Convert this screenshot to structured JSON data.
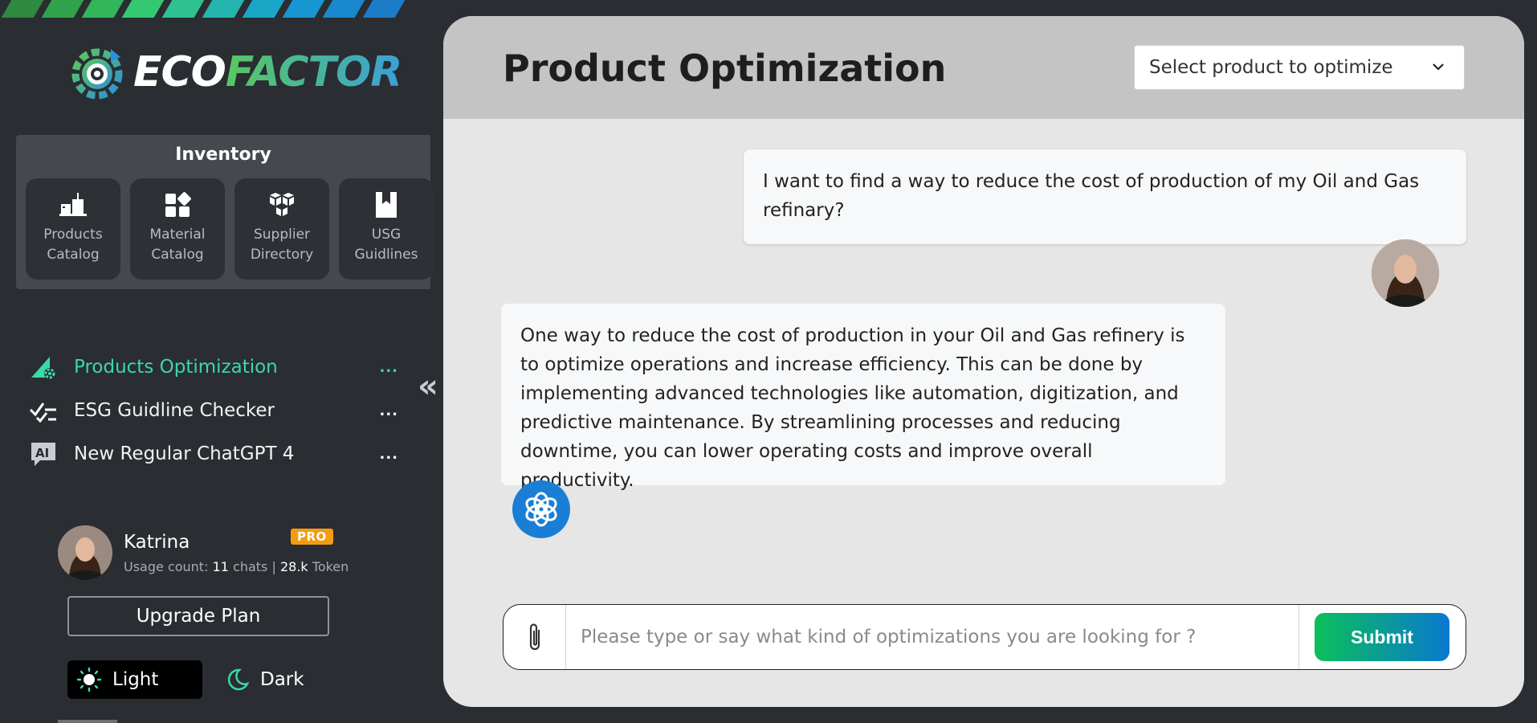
{
  "app": {
    "logo_eco": "ECO",
    "logo_factor": "FACTOR"
  },
  "colors": {
    "accent": "#3bd8a8",
    "sidebar_bg": "#2a2d32",
    "main_bg": "#e6e6e6",
    "header_bg": "#c4c4c4",
    "pro_badge": "#f39c12",
    "bot_avatar": "#1a7fd4"
  },
  "inventory": {
    "title": "Inventory",
    "cards": [
      {
        "icon": "products-catalog-icon",
        "line1": "Products",
        "line2": "Catalog"
      },
      {
        "icon": "material-catalog-icon",
        "line1": "Material",
        "line2": "Catalog"
      },
      {
        "icon": "supplier-directory-icon",
        "line1": "Supplier",
        "line2": "Directory"
      },
      {
        "icon": "usg-guidelines-icon",
        "line1": "USG",
        "line2": "Guidlines"
      }
    ]
  },
  "nav": {
    "items": [
      {
        "label": "Products Optimization",
        "icon": "optimization-icon",
        "active": true,
        "more": "..."
      },
      {
        "label": "ESG Guidline Checker",
        "icon": "checklist-icon",
        "active": false,
        "more": "..."
      },
      {
        "label": "New Regular ChatGPT 4",
        "icon": "ai-icon",
        "active": false,
        "more": "..."
      }
    ],
    "collapse_glyph": "«"
  },
  "profile": {
    "name": "Katrina",
    "badge": "PRO",
    "usage_prefix": "Usage count:",
    "chats_count": "11",
    "chats_label": "chats",
    "separator": "|",
    "tokens_count": "28.k",
    "tokens_label": "Token"
  },
  "upgrade_label": "Upgrade Plan",
  "theme": {
    "light_label": "Light",
    "dark_label": "Dark",
    "selected": "Light"
  },
  "header": {
    "title": "Product Optimization",
    "select_value": "Select product to optimize"
  },
  "chat": {
    "messages": [
      {
        "role": "user",
        "text": "I want to find a way to reduce the cost of production of my Oil and Gas refinary?"
      },
      {
        "role": "assistant",
        "text": "One way to reduce the cost of production in your Oil and Gas refinery is to optimize operations and increase efficiency. This can be done by implementing advanced technologies like automation, digitization, and predictive maintenance. By streamlining processes and reducing downtime, you can lower operating costs and improve overall productivity."
      }
    ]
  },
  "composer": {
    "placeholder": "Please type or say what kind of optimizations you are looking for ?",
    "value": "",
    "submit_label": "Submit"
  }
}
